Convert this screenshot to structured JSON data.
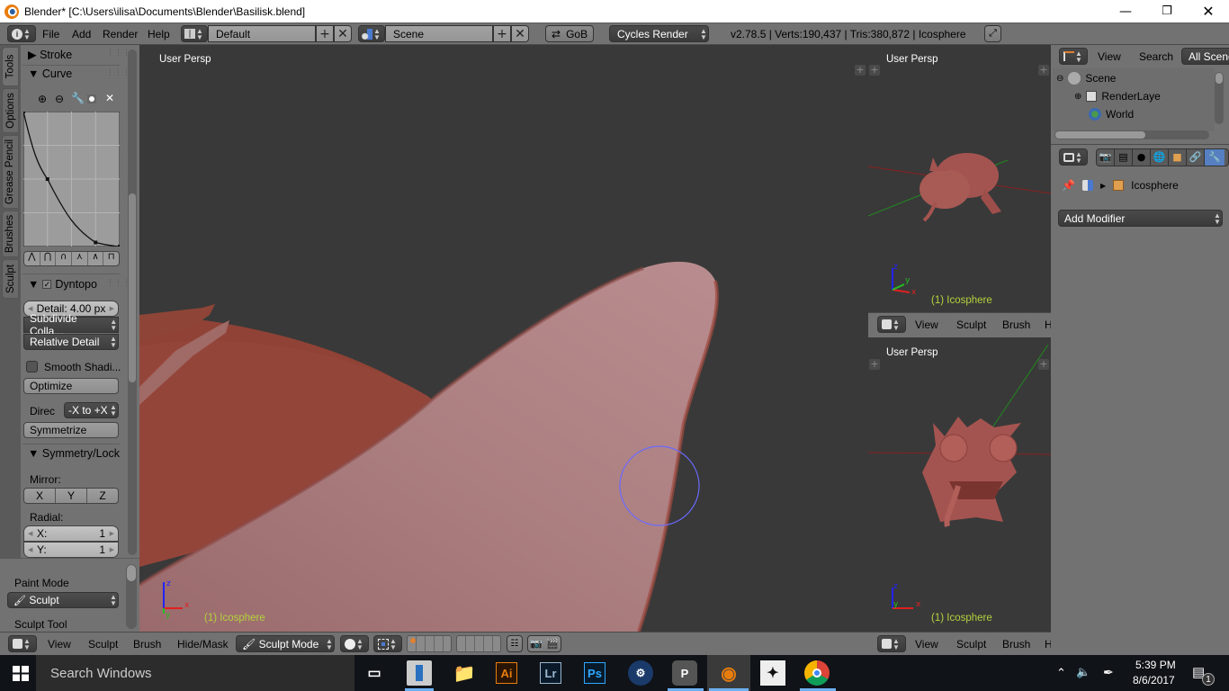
{
  "window": {
    "title": "Blender* [C:\\Users\\ilisa\\Documents\\Blender\\Basilisk.blend]",
    "controls": [
      "minimize",
      "restore",
      "close"
    ]
  },
  "info_header": {
    "menus": [
      "File",
      "Add",
      "Render",
      "Help"
    ],
    "screen_layout": "Default",
    "scene": "Scene",
    "gob_button": "GoB",
    "render_engine": "Cycles Render",
    "stats": "v2.78.5 | Verts:190,437 | Tris:380,872 | Icosphere"
  },
  "tool_tabs": [
    "Tools",
    "Options",
    "Grease Pencil",
    "Brushes",
    "Sculpt"
  ],
  "tool_panel": {
    "stroke_label": "Stroke",
    "curve_label": "Curve",
    "curve_points": [
      [
        0,
        1
      ],
      [
        0.25,
        0.5
      ],
      [
        0.75,
        0.03
      ],
      [
        1,
        0
      ]
    ],
    "dyntopo": {
      "label": "Dyntopo",
      "enabled": true,
      "detail": "Detail: 4.00 px",
      "method": "Subdivide Colla...",
      "detail_type": "Relative Detail",
      "smooth_shading_label": "Smooth Shadi...",
      "smooth_shading": false,
      "optimize_label": "Optimize",
      "direction_label": "Direc",
      "direction_value": "-X to +X",
      "symmetrize_label": "Symmetrize"
    },
    "symmetry": {
      "label": "Symmetry/Lock",
      "mirror_label": "Mirror:",
      "mirror_axes": [
        "X",
        "Y",
        "Z"
      ],
      "radial_label": "Radial:",
      "radial_x_label": "X:",
      "radial_x": "1",
      "radial_y_label": "Y:",
      "radial_y": "1"
    }
  },
  "lower_panel": {
    "paint_mode_label": "Paint Mode",
    "paint_mode_value": "Sculpt",
    "sculpt_tool_label": "Sculpt Tool"
  },
  "main_viewport": {
    "view_label": "User Persp",
    "object_label": "(1) Icosphere",
    "header_menus": [
      "View",
      "Sculpt",
      "Brush",
      "Hide/Mask"
    ],
    "mode": "Sculpt Mode"
  },
  "side_viewports": [
    {
      "view_label": "User Persp",
      "object_label": "(1) Icosphere",
      "header_menus": [
        "View",
        "Sculpt",
        "Brush",
        "H"
      ]
    },
    {
      "view_label": "User Persp",
      "object_label": "(1) Icosphere",
      "header_menus": [
        "View",
        "Sculpt",
        "Brush",
        "H"
      ]
    }
  ],
  "outliner": {
    "menus": [
      "View",
      "Search"
    ],
    "filter": "All Scene",
    "items": [
      {
        "label": "Scene",
        "expand": "-"
      },
      {
        "label": "RenderLaye",
        "expand": "+"
      },
      {
        "label": "World",
        "expand": ""
      }
    ]
  },
  "properties": {
    "object_name": "Icosphere",
    "add_modifier": "Add Modifier",
    "active_tab": "modifiers"
  },
  "taskbar": {
    "search_placeholder": "Search Windows",
    "apps": [
      "Task View",
      "Blender Launcher",
      "File Explorer",
      "Ai",
      "Lr",
      "Ps",
      "Steam",
      "PureRef",
      "Blender",
      "ZBrush",
      "Chrome"
    ],
    "time": "5:39 PM",
    "date": "8/6/2017",
    "notifications": "1"
  },
  "colors": {
    "accent_blue": "#5680c2",
    "object_label": "#b4d23c",
    "mesh": "#a0524a",
    "brush_circle": "#6a6aff"
  }
}
